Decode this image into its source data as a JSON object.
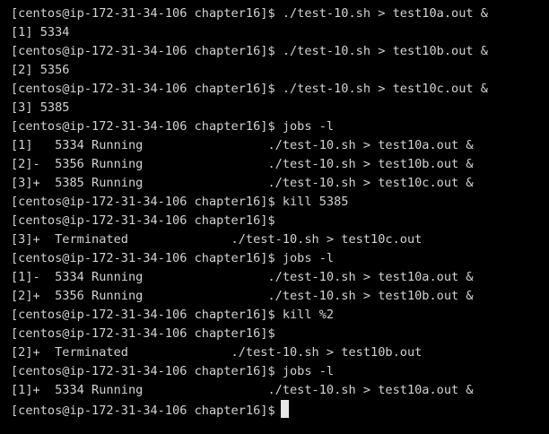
{
  "terminal": {
    "lines": [
      "[centos@ip-172-31-34-106 chapter16]$ ./test-10.sh > test10a.out &",
      "[1] 5334",
      "[centos@ip-172-31-34-106 chapter16]$ ./test-10.sh > test10b.out &",
      "[2] 5356",
      "[centos@ip-172-31-34-106 chapter16]$ ./test-10.sh > test10c.out &",
      "[3] 5385",
      "[centos@ip-172-31-34-106 chapter16]$ jobs -l",
      "[1]   5334 Running                 ./test-10.sh > test10a.out &",
      "[2]-  5356 Running                 ./test-10.sh > test10b.out &",
      "[3]+  5385 Running                 ./test-10.sh > test10c.out &",
      "[centos@ip-172-31-34-106 chapter16]$ kill 5385",
      "[centos@ip-172-31-34-106 chapter16]$",
      "[3]+  Terminated              ./test-10.sh > test10c.out",
      "[centos@ip-172-31-34-106 chapter16]$ jobs -l",
      "[1]-  5334 Running                 ./test-10.sh > test10a.out &",
      "[2]+  5356 Running                 ./test-10.sh > test10b.out &",
      "[centos@ip-172-31-34-106 chapter16]$ kill %2",
      "[centos@ip-172-31-34-106 chapter16]$",
      "[2]+  Terminated              ./test-10.sh > test10b.out",
      "[centos@ip-172-31-34-106 chapter16]$ jobs -l",
      "[1]+  5334 Running                 ./test-10.sh > test10a.out &"
    ],
    "prompt": "[centos@ip-172-31-34-106 chapter16]$",
    "colors": {
      "background": "#000000",
      "foreground": "#d3d3d3",
      "cursor": "#e6e6e6"
    }
  }
}
